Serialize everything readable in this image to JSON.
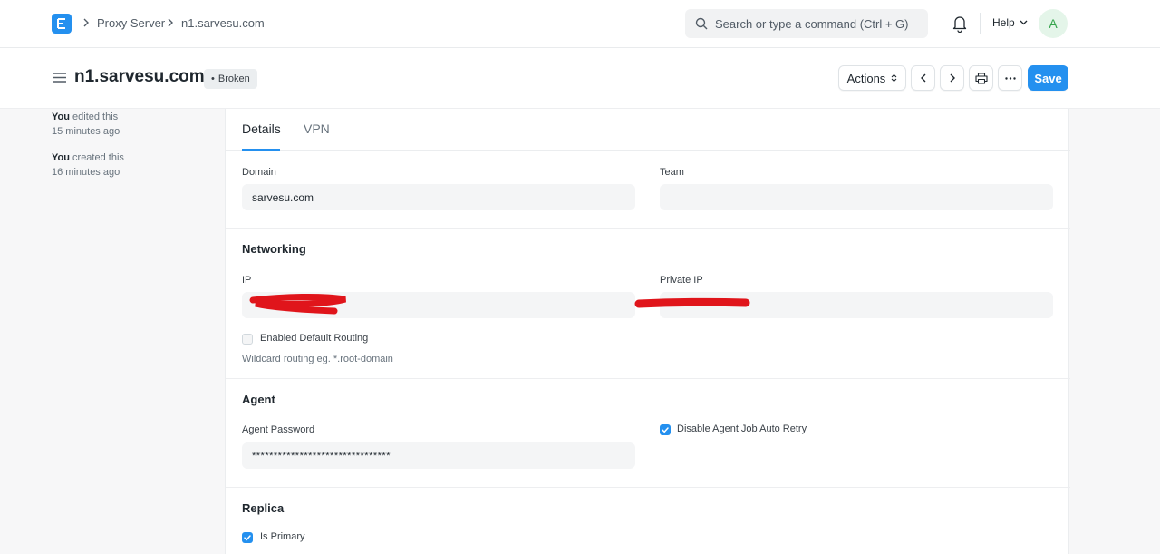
{
  "navbar": {
    "breadcrumbs": [
      "Proxy Server",
      "n1.sarvesu.com"
    ],
    "search_placeholder": "Search or type a command (Ctrl + G)",
    "help_label": "Help",
    "avatar_initial": "A"
  },
  "header": {
    "title": "n1.sarvesu.com",
    "status": "Broken",
    "actions_label": "Actions",
    "save_label": "Save"
  },
  "activity": [
    {
      "actor": "You",
      "action": "edited this",
      "time": "15 minutes ago"
    },
    {
      "actor": "You",
      "action": "created this",
      "time": "16 minutes ago"
    }
  ],
  "tabs": [
    {
      "label": "Details",
      "active": true
    },
    {
      "label": "VPN",
      "active": false
    }
  ],
  "form": {
    "domain": {
      "label": "Domain",
      "value": "sarvesu.com"
    },
    "team": {
      "label": "Team",
      "value": ""
    },
    "networking": {
      "title": "Networking",
      "ip_label": "IP",
      "private_ip_label": "Private IP",
      "default_routing": {
        "label": "Enabled Default Routing",
        "checked": false
      },
      "routing_description": "Wildcard routing eg. *.root-domain"
    },
    "agent": {
      "title": "Agent",
      "password_label": "Agent Password",
      "password_value": "********************************",
      "auto_retry": {
        "label": "Disable Agent Job Auto Retry",
        "checked": true
      }
    },
    "replica": {
      "title": "Replica",
      "is_primary": {
        "label": "Is Primary",
        "checked": true
      }
    }
  },
  "colors": {
    "primary": "#2490ef",
    "redaction": "#e0151b"
  }
}
